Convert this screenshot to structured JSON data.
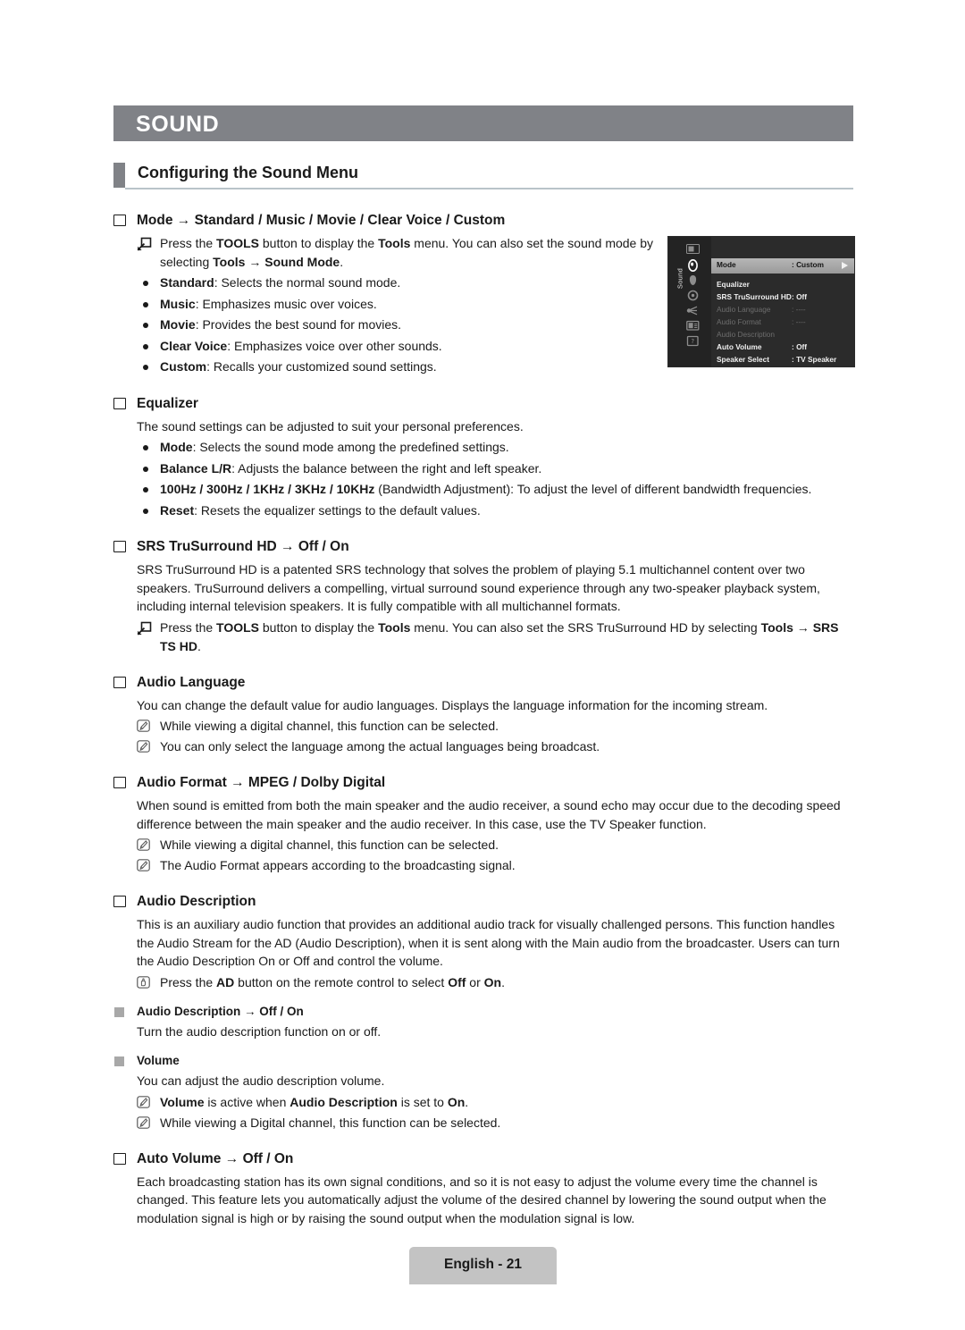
{
  "chapter": {
    "title": "SOUND"
  },
  "section": {
    "heading": "Configuring the Sound Menu"
  },
  "topics": {
    "mode": {
      "title_main": "Mode",
      "title_arrow": "→",
      "title_values": "Standard / Music / Movie / Clear Voice / Custom",
      "tools_note": {
        "t1": "Press the ",
        "b1": "TOOLS",
        "t2": " button to display the ",
        "b2": "Tools",
        "t3": " menu. You can also set the sound mode by selecting ",
        "b3": "Tools",
        "t4": " → ",
        "b4": "Sound Mode",
        "t5": "."
      },
      "bullets": [
        {
          "term": "Standard",
          "desc": ": Selects the normal sound mode."
        },
        {
          "term": "Music",
          "desc": ": Emphasizes music over voices."
        },
        {
          "term": "Movie",
          "desc": ": Provides the best sound for movies."
        },
        {
          "term": "Clear Voice",
          "desc": ": Emphasizes voice over other sounds."
        },
        {
          "term": "Custom",
          "desc": ": Recalls your customized sound settings."
        }
      ]
    },
    "equalizer": {
      "title": "Equalizer",
      "intro": "The sound settings can be adjusted to suit your personal preferences.",
      "bullets": [
        {
          "term": "Mode",
          "desc": ": Selects the sound mode among the predefined settings."
        },
        {
          "term": "Balance L/R",
          "desc": ": Adjusts the balance between the right and left speaker."
        },
        {
          "term": "100Hz / 300Hz / 1KHz / 3KHz / 10KHz",
          "desc": " (Bandwidth Adjustment): To adjust the level of different bandwidth frequencies."
        },
        {
          "term": "Reset",
          "desc": ": Resets the equalizer settings to the default values."
        }
      ]
    },
    "srs": {
      "title_main": "SRS TruSurround HD",
      "title_arrow": "→",
      "title_values": "Off / On",
      "body": "SRS TruSurround HD is a patented SRS technology that solves the problem of playing 5.1 multichannel content over two speakers. TruSurround delivers a compelling, virtual surround sound experience through any two-speaker playback system, including internal television speakers. It is fully compatible with all multichannel formats.",
      "tools_note": {
        "t1": "Press the ",
        "b1": "TOOLS",
        "t2": " button to display the ",
        "b2": "Tools",
        "t3": " menu. You can also set the SRS TruSurround HD by selecting ",
        "b3": "Tools",
        "t4": " → ",
        "b4": "SRS TS HD",
        "t5": "."
      }
    },
    "audio_language": {
      "title": "Audio Language",
      "body": "You can change the default value for audio languages. Displays the language information for the incoming stream.",
      "notes": [
        "While viewing a digital channel, this function can be selected.",
        "You can only select the language among the actual languages being broadcast."
      ]
    },
    "audio_format": {
      "title_main": "Audio Format",
      "title_arrow": "→",
      "title_values": "MPEG / Dolby Digital",
      "body": "When sound is emitted from both the main speaker and the audio receiver, a sound echo may occur due to the decoding speed difference between the main speaker and the audio receiver. In this case, use the TV Speaker function.",
      "notes": [
        "While viewing a digital channel, this function can be selected.",
        "The Audio Format appears according to the broadcasting signal."
      ]
    },
    "audio_description": {
      "title": "Audio Description",
      "body": "This is an auxiliary audio function that provides an additional audio track for visually challenged persons. This function handles the Audio Stream for the AD (Audio Description), when it is sent along with the Main audio from the broadcaster. Users can turn the Audio Description On or Off and control the volume.",
      "ad_note": {
        "t1": "Press the ",
        "b1": "AD",
        "t2": " button on the remote control to select ",
        "b2": "Off",
        "t3": " or ",
        "b3": "On",
        "t4": "."
      },
      "sub_ad": {
        "title_main": "Audio Description",
        "title_arrow": "→",
        "title_values": "Off / On",
        "body": "Turn the audio description function on or off."
      },
      "sub_volume": {
        "title": "Volume",
        "body": "You can adjust the audio description volume.",
        "note1": {
          "b1": "Volume",
          "t1": " is active when ",
          "b2": "Audio Description",
          "t2": " is set to ",
          "b3": "On",
          "t3": "."
        },
        "note2": "While viewing a Digital channel, this function can be selected."
      }
    },
    "auto_volume": {
      "title_main": "Auto Volume",
      "title_arrow": "→",
      "title_values": "Off / On",
      "body": "Each broadcasting station has its own signal conditions, and so it is not easy to adjust the volume every time the channel is changed. This feature lets you automatically adjust the volume of the desired channel by lowering the sound output when the modulation signal is high or by raising the sound output when the modulation signal is low."
    }
  },
  "osd": {
    "tab_label": "Sound",
    "sidebar_icons": [
      "picture-icon",
      "sound-icon",
      "channel-icon",
      "setup-icon",
      "input-icon",
      "application-icon",
      "support-icon"
    ],
    "items": [
      {
        "label": "Mode",
        "value": ": Custom",
        "state": "selected"
      },
      {
        "label": "Equalizer",
        "value": "",
        "state": "normal"
      },
      {
        "label": "SRS TruSurround HD",
        "value": ": Off",
        "state": "normal"
      },
      {
        "label": "Audio Language",
        "value": ": ----",
        "state": "dim"
      },
      {
        "label": "Audio Format",
        "value": ": ----",
        "state": "dim"
      },
      {
        "label": "Audio Description",
        "value": "",
        "state": "dim"
      },
      {
        "label": "Auto Volume",
        "value": ": Off",
        "state": "normal"
      },
      {
        "label": "Speaker Select",
        "value": ": TV Speaker",
        "state": "normal"
      }
    ]
  },
  "footer": {
    "label": "English - 21"
  },
  "colors": {
    "banner_gray": "#808287",
    "rule_blue_gray": "#b9c3c9",
    "sub_bullet_gray": "#a8a8a8",
    "footer_gray": "#c3c3c3",
    "osd_dark": "#2b2b2b",
    "osd_highlight": "#b6b6b6"
  }
}
